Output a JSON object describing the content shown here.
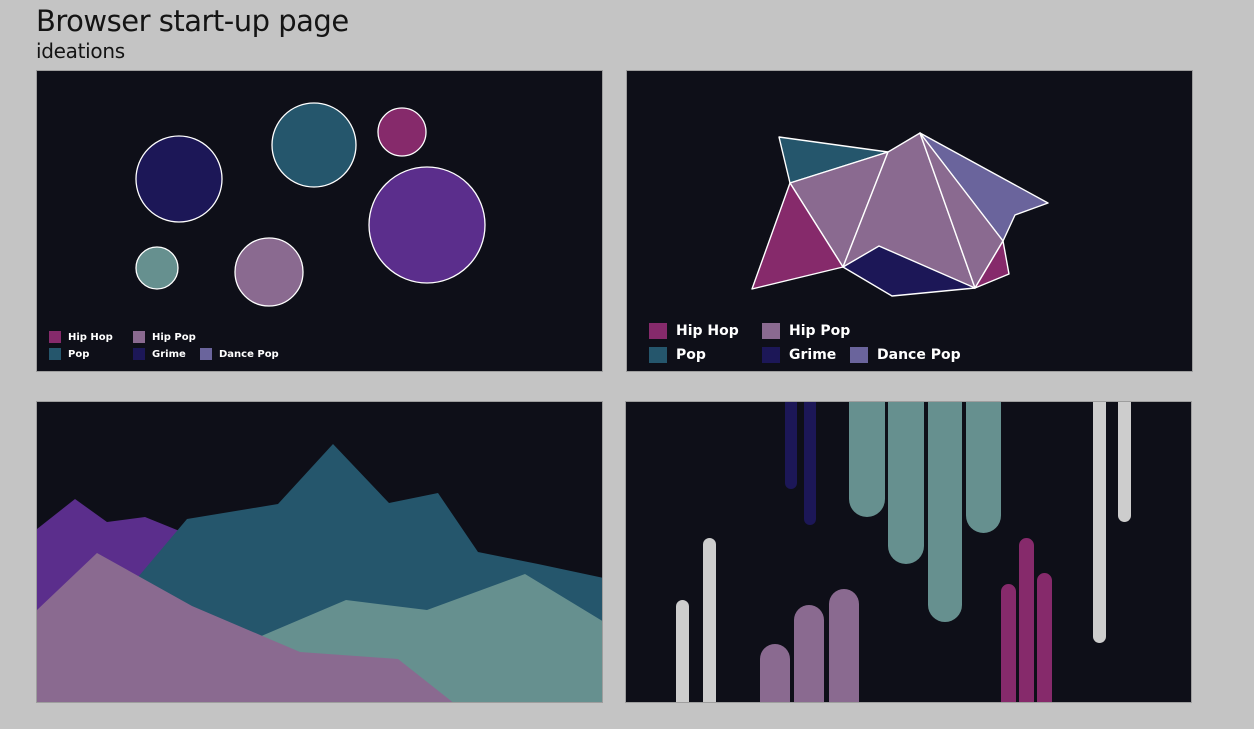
{
  "page": {
    "title": "Browser start-up page",
    "subtitle": "ideations"
  },
  "colors": {
    "hip_hop": "#862a6b",
    "hip_pop": "#8a6a90",
    "pop": "#25566c",
    "grime": "#1c1757",
    "dance_pop": "#6a649c",
    "purple": "#5b2e8c",
    "teal_light": "#66908f",
    "grey_bar": "#cdcdcd",
    "panel_bg": "#0e0f18",
    "outline": "#ffffff"
  },
  "legend": [
    {
      "key": "hip_hop",
      "label": "Hip Hop",
      "color": "#862a6b"
    },
    {
      "key": "hip_pop",
      "label": "Hip Pop",
      "color": "#8a6a90"
    },
    {
      "key": "pop",
      "label": "Pop",
      "color": "#25566c"
    },
    {
      "key": "grime",
      "label": "Grime",
      "color": "#1c1757"
    },
    {
      "key": "dance_pop",
      "label": "Dance Pop",
      "color": "#6a649c"
    }
  ],
  "ideations": [
    {
      "id": "bubbles",
      "style": "circles with white outlines"
    },
    {
      "id": "polygons",
      "style": "faceted triangles with white outlines"
    },
    {
      "id": "mountains",
      "style": "layered area ranges"
    },
    {
      "id": "bars",
      "style": "rounded hanging and standing bars"
    }
  ]
}
